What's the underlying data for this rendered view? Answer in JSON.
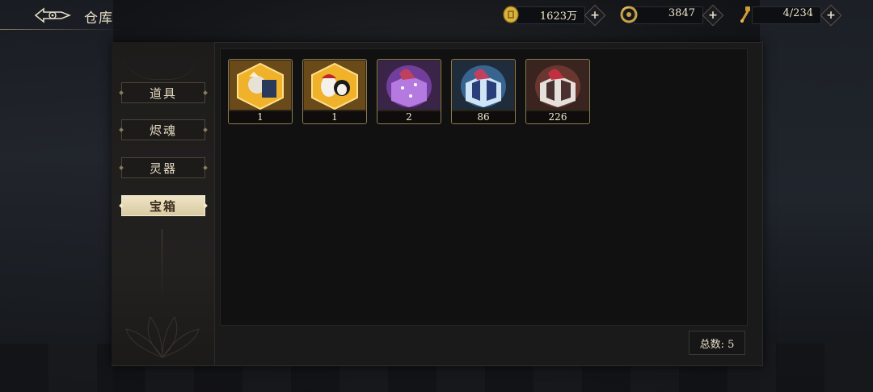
{
  "header": {
    "title": "仓库",
    "back_icon": "ornate-back-arrow-icon"
  },
  "currencies": [
    {
      "name": "gold-coin",
      "icon": "coin-icon",
      "value": "1623万",
      "color": "#d9b13c"
    },
    {
      "name": "jade",
      "icon": "dragon-jade-icon",
      "value": "3847",
      "color": "#c9a24a"
    },
    {
      "name": "stamina",
      "icon": "scroll-key-icon",
      "value": "4/234",
      "color": "#d09a3a"
    }
  ],
  "sidebar": {
    "tabs": [
      {
        "label": "道具",
        "active": false
      },
      {
        "label": "烬魂",
        "active": false
      },
      {
        "label": "灵器",
        "active": false
      },
      {
        "label": "宝箱",
        "active": true
      }
    ]
  },
  "items": [
    {
      "count": "1",
      "kind": "gold-hexagon-character-chest",
      "frame": "#e0a82a"
    },
    {
      "count": "1",
      "kind": "gold-hexagon-mask-chest",
      "frame": "#e0a82a"
    },
    {
      "count": "2",
      "kind": "purple-gift-box",
      "frame": "#9a5ad0"
    },
    {
      "count": "86",
      "kind": "blue-gift-box",
      "frame": "#4a88c8"
    },
    {
      "count": "226",
      "kind": "red-gift-box",
      "frame": "#b05a4a"
    }
  ],
  "footer": {
    "total_label": "总数: 5"
  }
}
